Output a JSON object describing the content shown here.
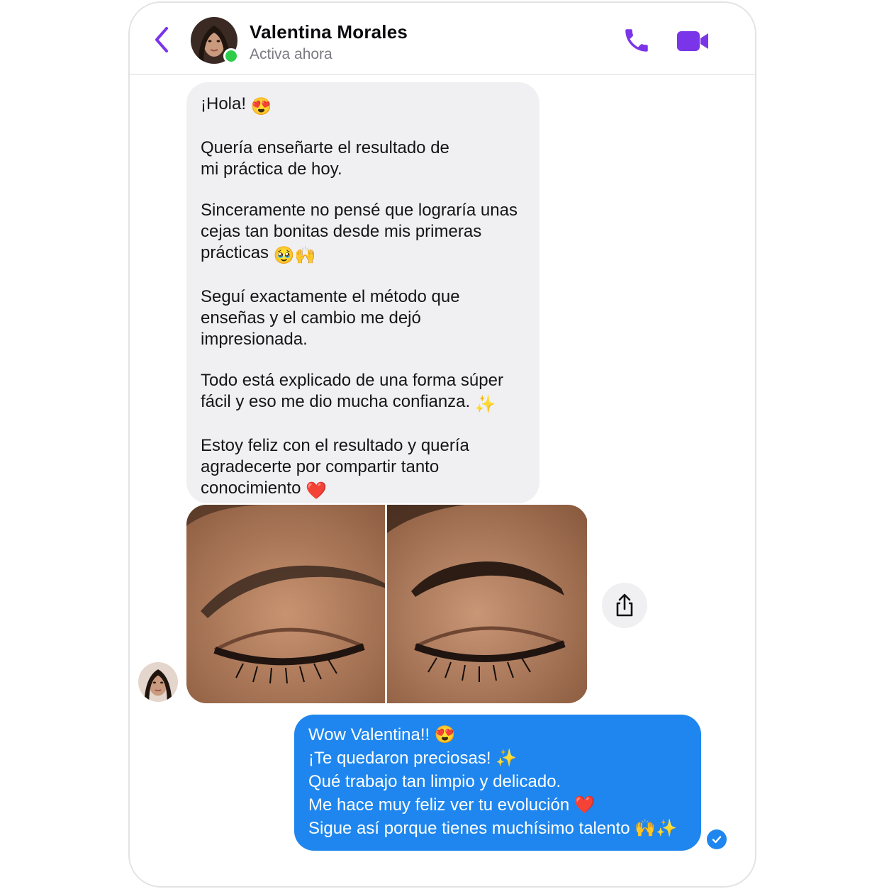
{
  "header": {
    "contact_name": "Valentina Morales",
    "status": "Activa ahora",
    "icons": {
      "back": "chevron-left-icon",
      "call": "phone-icon",
      "video": "video-camera-icon"
    },
    "accent_color": "#7b35e8",
    "online_color": "#2ecc48"
  },
  "incoming_message": {
    "paragraphs": [
      {
        "text": "¡Hola!",
        "emoji": "😍"
      },
      {
        "text": "Quería enseñarte el resultado de\nmi práctica de hoy.",
        "emoji": ""
      },
      {
        "text": "Sinceramente no pensé que lograría unas cejas tan bonitas desde mis primeras prácticas",
        "emoji": "🥹🙌"
      },
      {
        "text": "Seguí exactamente el método que enseñas y el cambio me dejó impresionada.",
        "emoji": ""
      },
      {
        "text": "Todo está explicado de una forma súper fácil y eso me dio mucha confianza.",
        "emoji": "✨"
      },
      {
        "text": "Estoy feliz con el resultado y quería agradecerte por compartir tanto conocimiento",
        "emoji": "❤️"
      }
    ],
    "bubble_color": "#f0f0f2"
  },
  "photo": {
    "panels": [
      "before-eyebrow-photo",
      "after-eyebrow-photo"
    ]
  },
  "share_icon": "share-icon",
  "outgoing_message": {
    "lines": [
      "Wow Valentina!! 😍",
      "¡Te quedaron preciosas! ✨",
      "Qué trabajo tan limpio y delicado.",
      "Me hace muy feliz ver tu evolución ❤️",
      "Sigue así porque tienes muchísimo talento 🙌✨"
    ],
    "bubble_color": "#1e86ee"
  },
  "read_receipt_icon": "check-circle-icon"
}
